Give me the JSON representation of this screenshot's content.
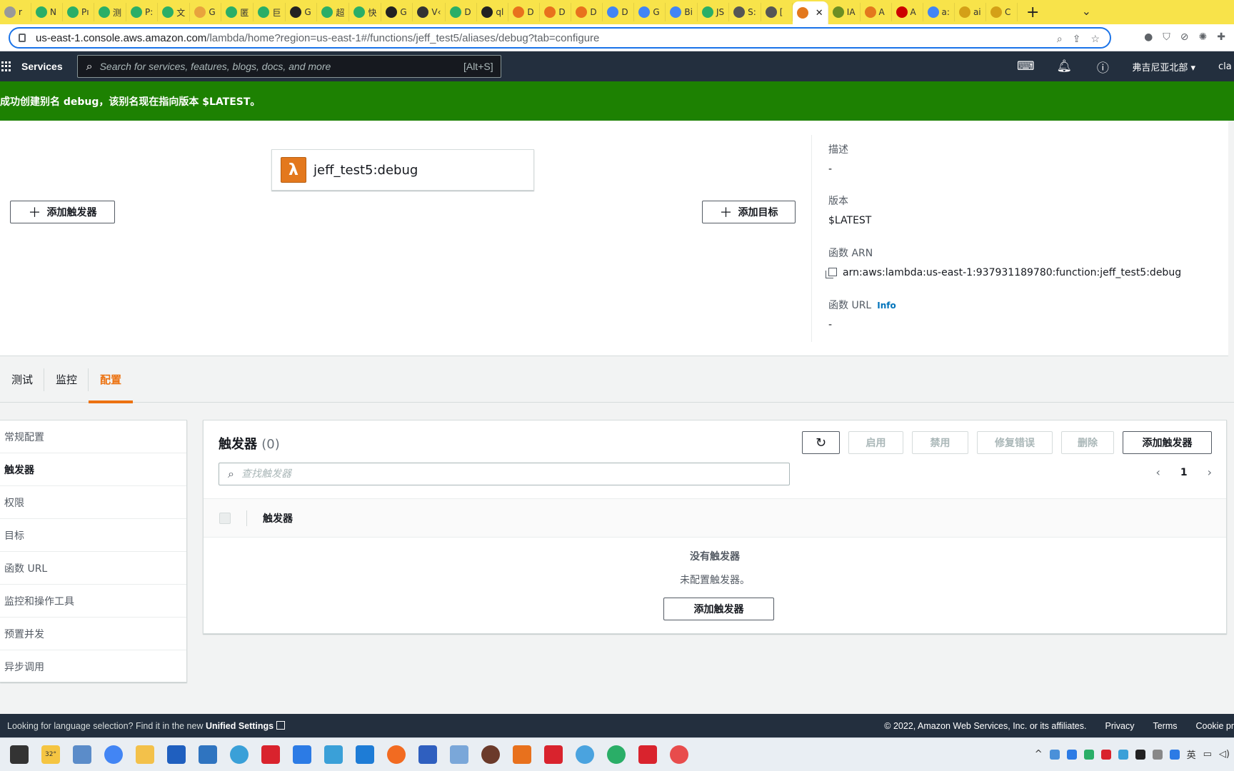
{
  "browser": {
    "tabs": [
      {
        "label": "r",
        "color": "#999"
      },
      {
        "label": "N",
        "color": "#2aae67"
      },
      {
        "label": "Pı",
        "color": "#2aae67"
      },
      {
        "label": "测",
        "color": "#2aae67"
      },
      {
        "label": "P:",
        "color": "#2aae67"
      },
      {
        "label": "文",
        "color": "#2aae67"
      },
      {
        "label": "G",
        "color": "#e8a33d"
      },
      {
        "label": "匿",
        "color": "#2aae67"
      },
      {
        "label": "巨",
        "color": "#2aae67"
      },
      {
        "label": "G",
        "color": "#222"
      },
      {
        "label": "超",
        "color": "#2aae67"
      },
      {
        "label": "快",
        "color": "#2aae67"
      },
      {
        "label": "G",
        "color": "#222"
      },
      {
        "label": "V‹",
        "color": "#333"
      },
      {
        "label": "D",
        "color": "#2aae67"
      },
      {
        "label": "ql",
        "color": "#222"
      },
      {
        "label": "D",
        "color": "#e8711d"
      },
      {
        "label": "D",
        "color": "#e8711d"
      },
      {
        "label": "D",
        "color": "#e8711d"
      },
      {
        "label": "D",
        "color": "#4285f4"
      },
      {
        "label": "G",
        "color": "#4285f4"
      },
      {
        "label": "Bi",
        "color": "#4285f4"
      },
      {
        "label": "JS",
        "color": "#2aae67"
      },
      {
        "label": "S:",
        "color": "#555"
      },
      {
        "label": "[",
        "color": "#555"
      }
    ],
    "active_tab": {
      "label": "",
      "color": "#e3781d"
    },
    "tabs_after": [
      {
        "label": "IA",
        "color": "#6b8e23"
      },
      {
        "label": "A",
        "color": "#e3781d"
      },
      {
        "label": "A",
        "color": "#cc0000"
      },
      {
        "label": "a:",
        "color": "#4285f4"
      },
      {
        "label": "ai",
        "color": "#d4a017"
      },
      {
        "label": "C",
        "color": "#d4a017"
      }
    ],
    "url_host": "us-east-1.console.aws.amazon.com",
    "url_path": "/lambda/home?region=us-east-1#/functions/jeff_test5/aliases/debug?tab=configure"
  },
  "aws_nav": {
    "services_label": "Services",
    "search_placeholder": "Search for services, features, blogs, docs, and more",
    "search_shortcut": "[Alt+S]",
    "region": "弗吉尼亚北部",
    "user": "cla"
  },
  "flash": {
    "message": "成功创建别名 debug，该别名现在指向版本 $LATEST。"
  },
  "overview": {
    "function_name": "jeff_test5:debug",
    "lambda_logo_glyph": "λ",
    "add_trigger_label": "添加触发器",
    "add_destination_label": "添加目标",
    "description_label": "描述",
    "description_value": "-",
    "version_label": "版本",
    "version_value": "$LATEST",
    "arn_label": "函数 ARN",
    "arn_value": "arn:aws:lambda:us-east-1:937931189780:function:jeff_test5:debug",
    "url_label": "函数 URL",
    "url_info": "Info",
    "url_value": "-"
  },
  "tabs": [
    "测试",
    "监控",
    "配置"
  ],
  "sidenav": [
    "常规配置",
    "触发器",
    "权限",
    "目标",
    "函数 URL",
    "监控和操作工具",
    "预置并发",
    "异步调用"
  ],
  "triggers": {
    "title": "触发器",
    "count": "(0)",
    "enable_label": "启用",
    "disable_label": "禁用",
    "fix_label": "修复错误",
    "delete_label": "删除",
    "add_label": "添加触发器",
    "filter_placeholder": "查找触发器",
    "page_number": "1",
    "column_header": "触发器",
    "empty_title": "没有触发器",
    "empty_sub": "未配置触发器。",
    "empty_add_label": "添加触发器"
  },
  "footer": {
    "lang_text": "Looking for language selection? Find it in the new",
    "unified_settings": "Unified Settings",
    "copyright": "© 2022, Amazon Web Services, Inc. or its affiliates.",
    "privacy": "Privacy",
    "terms": "Terms",
    "cookie": "Cookie pr"
  },
  "taskbar": {
    "weather": "32°",
    "ime": "英"
  },
  "colors": {
    "aws_nav": "#232f3e",
    "flash_success": "#1d8102",
    "accent_orange": "#ec7211",
    "link_blue": "#0073bb"
  }
}
